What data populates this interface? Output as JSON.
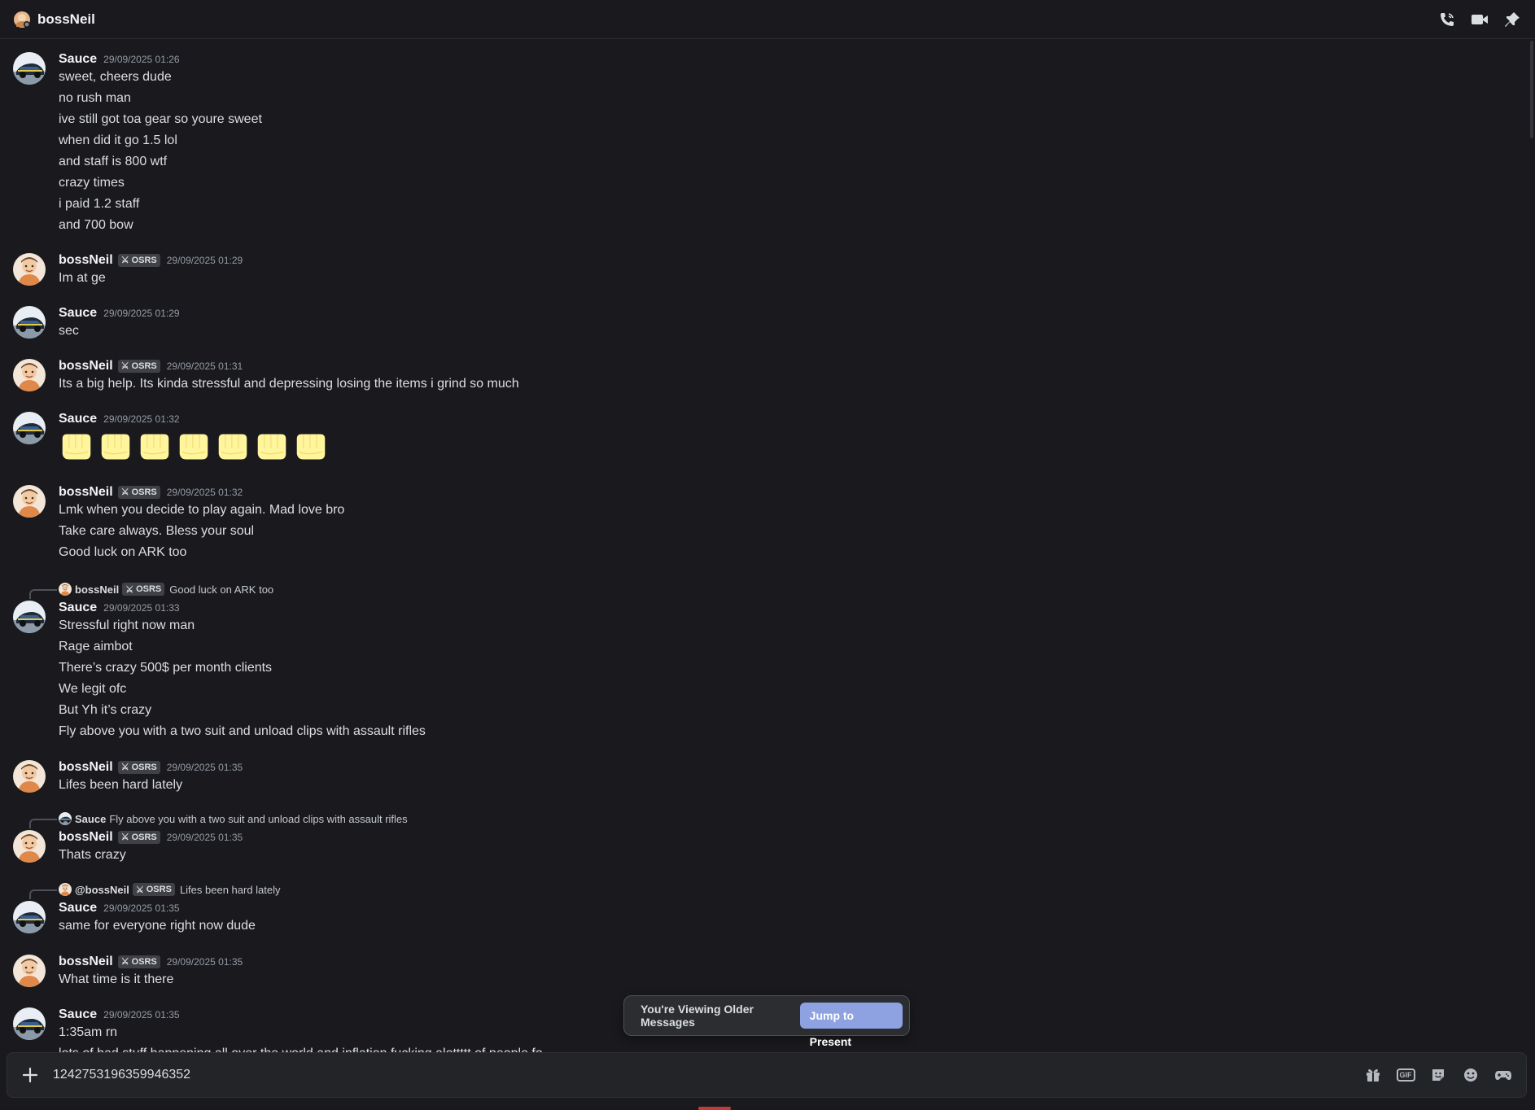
{
  "header": {
    "title": "bossNeil",
    "icons": [
      "phone-icon",
      "video-icon",
      "pin-icon"
    ]
  },
  "badge_label": "OSRS",
  "messages": [
    {
      "author": "Sauce",
      "time": "29/09/2025 01:26",
      "lines": [
        "sweet, cheers dude",
        "no rush man",
        "ive still got toa gear so youre sweet",
        "when did it go 1.5 lol",
        "and staff is 800 wtf",
        "crazy times",
        "i paid 1.2 staff",
        "and 700 bow"
      ]
    },
    {
      "author": "bossNeil",
      "time": "29/09/2025 01:29",
      "lines": [
        "Im at ge"
      ]
    },
    {
      "author": "Sauce",
      "time": "29/09/2025 01:29",
      "lines": [
        "sec"
      ]
    },
    {
      "author": "bossNeil",
      "time": "29/09/2025 01:31",
      "lines": [
        "Its a big help. Its kinda stressful and depressing losing the items i grind so much"
      ]
    },
    {
      "author": "Sauce",
      "time": "29/09/2025 01:32",
      "emoji": "fist-bump-emoji",
      "emoji_count": 7
    },
    {
      "author": "bossNeil",
      "time": "29/09/2025 01:32",
      "lines": [
        "Lmk when you decide to play again. Mad love bro",
        "Take care always. Bless your soul",
        "Good luck on ARK too"
      ]
    },
    {
      "reply_author": "bossNeil",
      "reply_text": "Good luck on ARK too",
      "author": "Sauce",
      "time": "29/09/2025 01:33",
      "lines": [
        "Stressful right now man",
        "Rage aimbot",
        "There’s crazy 500$ per month clients",
        "We legit ofc",
        "But Yh it’s crazy",
        "Fly above you with a two suit and unload clips with assault rifles"
      ]
    },
    {
      "author": "bossNeil",
      "time": "29/09/2025 01:35",
      "lines": [
        "Lifes been hard lately"
      ]
    },
    {
      "reply_author": "Sauce",
      "reply_text": "Fly above you with a two suit and unload clips with assault rifles",
      "author": "bossNeil",
      "time": "29/09/2025 01:35",
      "lines": [
        "Thats crazy"
      ]
    },
    {
      "reply_author": "@bossNeil",
      "reply_text": "Lifes been hard lately",
      "author": "Sauce",
      "time": "29/09/2025 01:35",
      "lines": [
        "same for everyone right now dude"
      ]
    },
    {
      "author": "bossNeil",
      "time": "29/09/2025 01:35",
      "lines": [
        "What time is it there"
      ]
    },
    {
      "author": "Sauce",
      "time": "29/09/2025 01:35",
      "lines": [
        "1:35am rn",
        "lots of bad stuff happening all over the world and inflation fucking alottttt of people fo"
      ]
    }
  ],
  "jump_bar": {
    "text": "You're Viewing Older Messages",
    "button": "Jump to Present"
  },
  "composer": {
    "value": "1242753196359946352",
    "icons": [
      "gift-icon",
      "gif-icon",
      "sticker-icon",
      "emoji-icon",
      "apps-icon"
    ],
    "gif_label": "GIF"
  },
  "colors": {
    "background": "#1a1a1e",
    "accent": "#8ea1e1",
    "emoji_yellow": "#fff59d"
  }
}
